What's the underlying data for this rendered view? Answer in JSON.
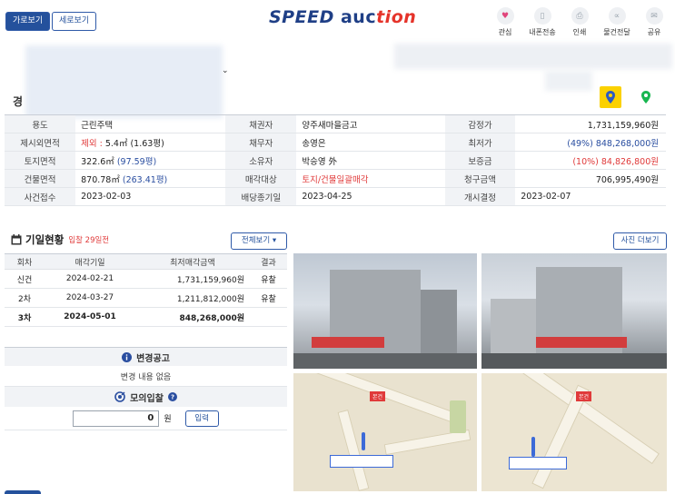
{
  "header": {
    "btn_horizontal": "가로보기",
    "btn_vertical": "세로보기",
    "logo_speed": "SPEED",
    "logo_auc": "auc",
    "logo_tion": "tion",
    "icons": [
      {
        "icon": "heart-icon",
        "label": "관심"
      },
      {
        "icon": "phone-icon",
        "label": "내폰전송"
      },
      {
        "icon": "print-icon",
        "label": "인쇄"
      },
      {
        "icon": "share-nodes-icon",
        "label": "물건전달"
      },
      {
        "icon": "mail-icon",
        "label": "공유"
      }
    ]
  },
  "case_prefix": "경",
  "info": {
    "rows": [
      [
        {
          "label": "용도",
          "value": "근린주택"
        },
        {
          "label": "채권자",
          "value": "양주새마을금고"
        },
        {
          "label": "감정가",
          "value": "1,731,159,960원"
        }
      ],
      [
        {
          "label": "제시외면적",
          "value_red": "제외 : ",
          "value": "5.4㎡ (1.63평)"
        },
        {
          "label": "채무자",
          "value": "송영은"
        },
        {
          "label": "최저가",
          "value_blue": "(49%) 848,268,000원"
        }
      ],
      [
        {
          "label": "토지면적",
          "value": "322.6㎡ ",
          "value_blue": "(97.59평)"
        },
        {
          "label": "소유자",
          "value": "박승영 外"
        },
        {
          "label": "보증금",
          "value_red": "(10%) 84,826,800원"
        }
      ],
      [
        {
          "label": "건물면적",
          "value": "870.78㎡ ",
          "value_blue": "(263.41평)"
        },
        {
          "label": "매각대상",
          "value_red": "토지/건물일괄매각"
        },
        {
          "label": "청구금액",
          "value": "706,995,490원"
        }
      ],
      [
        {
          "label": "사건접수",
          "value": "2023-02-03"
        },
        {
          "label": "배당종기일",
          "value": "2023-04-25"
        },
        {
          "label": "개시결정",
          "value": "2023-02-07"
        }
      ]
    ]
  },
  "schedule": {
    "title": "기일현황",
    "subtitle": "입찰 29일전",
    "btn_all": "전체보기 ▾",
    "btn_photo": "사진 더보기",
    "columns": [
      "회차",
      "매각기일",
      "최저매각금액",
      "결과"
    ],
    "rows": [
      {
        "round": "신건",
        "date": "2024-02-21",
        "amount": "1,731,159,960원",
        "result": "유찰"
      },
      {
        "round": "2차",
        "date": "2024-03-27",
        "amount": "1,211,812,000원",
        "result": "유찰"
      },
      {
        "round": "3차",
        "date": "2024-05-01",
        "amount": "848,268,000원",
        "result": ""
      }
    ]
  },
  "notice": {
    "title": "변경공고",
    "body": "변경 내용 없음"
  },
  "mock_bid": {
    "title": "모의입찰",
    "value": "0",
    "unit": "원",
    "btn": "입력"
  },
  "map_badges": [
    "본건",
    "본건"
  ],
  "colors": {
    "brand": "#24519c",
    "red": "#e03a3a",
    "blue": "#2a4ea0"
  }
}
